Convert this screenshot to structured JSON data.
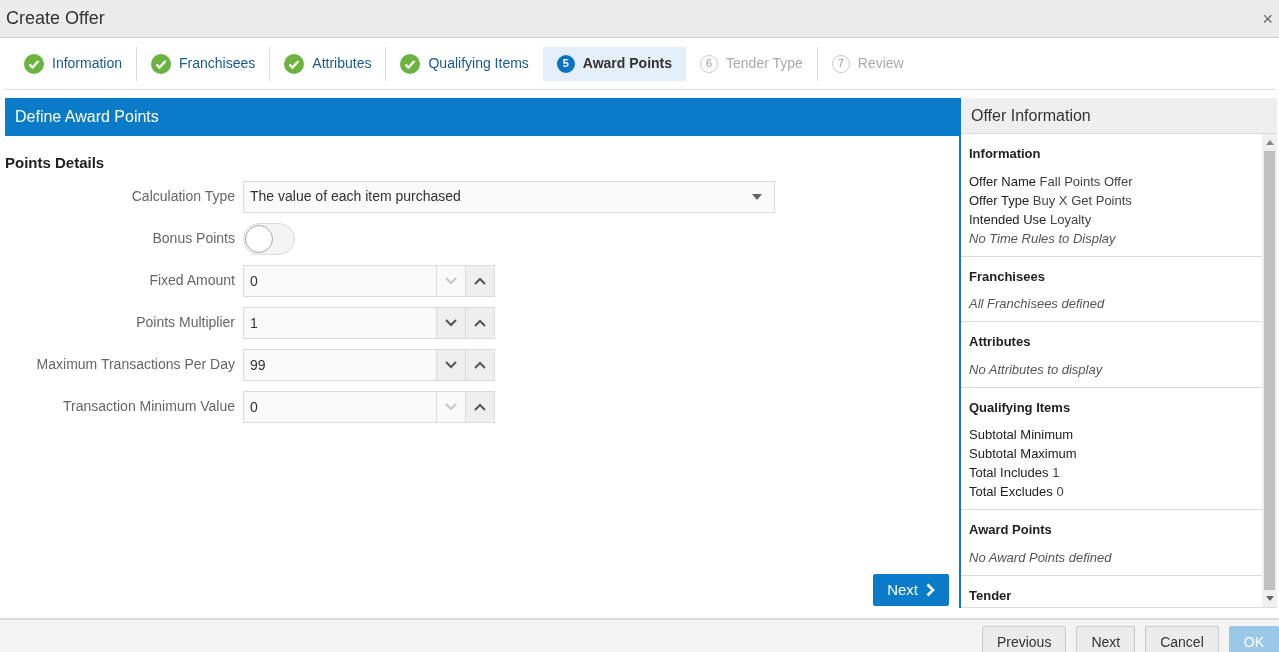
{
  "window": {
    "title": "Create Offer",
    "close": "×"
  },
  "steps": [
    {
      "label": "Information",
      "kind": "done",
      "selected": false
    },
    {
      "label": "Franchisees",
      "kind": "done",
      "selected": false
    },
    {
      "label": "Attributes",
      "kind": "done",
      "selected": false
    },
    {
      "label": "Qualifying Items",
      "kind": "done",
      "selected": false
    },
    {
      "label": "Award Points",
      "kind": "current",
      "number": "5",
      "selected": true
    },
    {
      "label": "Tender Type",
      "kind": "pending",
      "number": "6",
      "selected": false
    },
    {
      "label": "Review",
      "kind": "pending",
      "number": "7",
      "selected": false
    }
  ],
  "main": {
    "header": "Define Award Points",
    "section": "Points Details",
    "fields": [
      {
        "kind": "select",
        "label": "Calculation Type",
        "value": "The value of each item purchased"
      },
      {
        "kind": "toggle",
        "label": "Bonus Points",
        "on": false
      },
      {
        "kind": "spinner",
        "label": "Fixed Amount",
        "value": "0",
        "down_disabled": true
      },
      {
        "kind": "spinner",
        "label": "Points Multiplier",
        "value": "1",
        "down_disabled": false
      },
      {
        "kind": "spinner",
        "label": "Maximum Transactions Per Day",
        "value": "99",
        "down_disabled": false
      },
      {
        "kind": "spinner",
        "label": "Transaction Minimum Value",
        "value": "0",
        "down_disabled": true
      }
    ],
    "next_button": "Next"
  },
  "sidebar": {
    "title": "Offer Information",
    "sections": [
      {
        "title": "Information",
        "lines": [
          {
            "kind": "pair",
            "label": "Offer Name",
            "value": "Fall Points Offer"
          },
          {
            "kind": "pair",
            "label": "Offer Type",
            "value": "Buy X Get Points"
          },
          {
            "kind": "pair",
            "label": "Intended Use",
            "value": "Loyalty"
          },
          {
            "kind": "note",
            "text": "No Time Rules to Display"
          }
        ]
      },
      {
        "title": "Franchisees",
        "lines": [
          {
            "kind": "note",
            "text": "All Franchisees defined"
          }
        ]
      },
      {
        "title": "Attributes",
        "lines": [
          {
            "kind": "note",
            "text": "No Attributes to display"
          }
        ]
      },
      {
        "title": "Qualifying Items",
        "lines": [
          {
            "kind": "pair",
            "label": "Subtotal Minimum"
          },
          {
            "kind": "pair",
            "label": "Subtotal Maximum"
          },
          {
            "kind": "pair",
            "label": "Total Includes",
            "value": "1"
          },
          {
            "kind": "pair",
            "label": "Total Excludes",
            "value": "0"
          }
        ]
      },
      {
        "title": "Award Points",
        "lines": [
          {
            "kind": "note",
            "text": "No Award Points defined"
          }
        ]
      },
      {
        "title": "Tender"
      }
    ]
  },
  "footer": [
    {
      "label": "Previous",
      "disabled": false
    },
    {
      "label": "Next",
      "disabled": false
    },
    {
      "label": "Cancel",
      "disabled": false
    },
    {
      "label": "OK",
      "disabled": true
    }
  ]
}
